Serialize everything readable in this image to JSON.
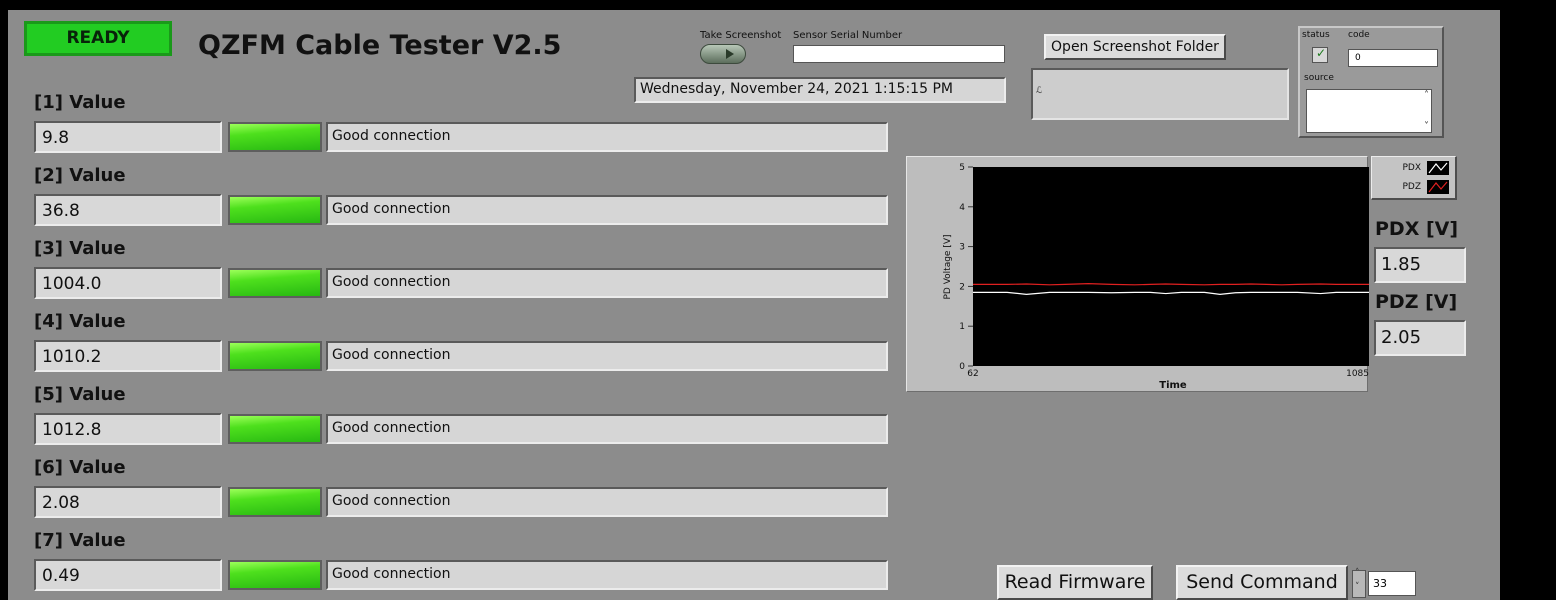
{
  "app": {
    "status_indicator": "READY",
    "title": "QZFM Cable Tester V2.5",
    "colors": {
      "panel": "#8c8c8c",
      "led_green": "#4ee01d",
      "ready_green": "#22cc22"
    }
  },
  "screenshot": {
    "take_label": "Take Screenshot",
    "serial_label": "Sensor Serial Number",
    "serial_value": "",
    "open_folder_label": "Open Screenshot Folder",
    "folder_path": ""
  },
  "datetime": "Wednesday, November 24, 2021   1:15:15 PM",
  "error_cluster": {
    "status_label": "status",
    "code_label": "code",
    "code_value": "0",
    "source_label": "source",
    "source_value": ""
  },
  "channels": [
    {
      "label": "[1] Value",
      "value": "9.8",
      "status": "Good connection"
    },
    {
      "label": "[2] Value",
      "value": "36.8",
      "status": "Good connection"
    },
    {
      "label": "[3] Value",
      "value": "1004.0",
      "status": "Good connection"
    },
    {
      "label": "[4] Value",
      "value": "1010.2",
      "status": "Good connection"
    },
    {
      "label": "[5] Value",
      "value": "1012.8",
      "status": "Good connection"
    },
    {
      "label": "[6] Value",
      "value": "2.08",
      "status": "Good connection"
    },
    {
      "label": "[7] Value",
      "value": "0.49",
      "status": "Good connection"
    }
  ],
  "chart_data": {
    "type": "line",
    "xlabel": "Time",
    "ylabel": "PD Voltage [V]",
    "xlim": [
      62,
      1085
    ],
    "ylim": [
      0,
      5
    ],
    "xticks": [
      "62",
      "1085"
    ],
    "yticks": [
      "0",
      "1",
      "2",
      "3",
      "4",
      "5"
    ],
    "legend_position": "right",
    "series": [
      {
        "name": "PDX",
        "color": "#ffffff",
        "x": [
          62,
          150,
          200,
          260,
          300,
          360,
          420,
          480,
          520,
          560,
          600,
          660,
          700,
          740,
          780,
          820,
          860,
          900,
          960,
          1000,
          1040,
          1085
        ],
        "y": [
          1.85,
          1.85,
          1.8,
          1.85,
          1.85,
          1.85,
          1.84,
          1.85,
          1.85,
          1.82,
          1.85,
          1.85,
          1.8,
          1.84,
          1.85,
          1.85,
          1.85,
          1.85,
          1.82,
          1.85,
          1.85,
          1.85
        ]
      },
      {
        "name": "PDZ",
        "color": "#e02020",
        "x": [
          62,
          150,
          200,
          260,
          300,
          360,
          420,
          480,
          520,
          560,
          600,
          660,
          700,
          740,
          780,
          820,
          860,
          900,
          960,
          1000,
          1040,
          1085
        ],
        "y": [
          2.05,
          2.05,
          2.06,
          2.04,
          2.05,
          2.07,
          2.05,
          2.04,
          2.05,
          2.06,
          2.05,
          2.04,
          2.05,
          2.05,
          2.06,
          2.05,
          2.04,
          2.05,
          2.06,
          2.05,
          2.05,
          2.05
        ]
      }
    ]
  },
  "readouts": {
    "pdx_label": "PDX [V]",
    "pdx_value": "1.85",
    "pdz_label": "PDZ [V]",
    "pdz_value": "2.05"
  },
  "bottom": {
    "read_firmware_label": "Read Firmware",
    "send_command_label": "Send Command",
    "command_value": "33"
  }
}
